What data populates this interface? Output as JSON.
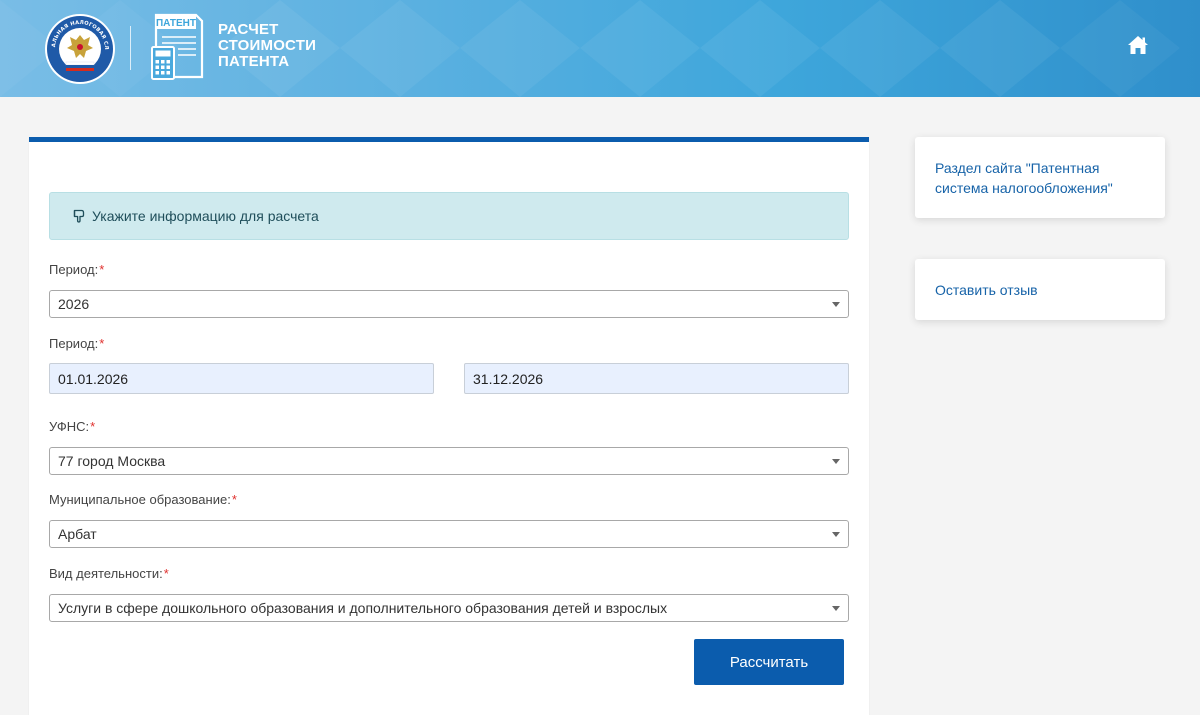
{
  "header": {
    "app_title": "РАСЧЕТ\nСТОИМОСТИ\nПАТЕНТА",
    "patent_icon_label": "ПАТЕНТ",
    "emblem_text": "ФЕДЕРАЛЬНАЯ НАЛОГОВАЯ СЛУЖБА",
    "home_icon": "home-icon"
  },
  "form": {
    "info_icon": "pointing-hand-icon",
    "info_text": "Укажите информацию для расчета",
    "required_mark": "*",
    "period_year": {
      "label": "Период:",
      "value": "2026"
    },
    "period_dates": {
      "label": "Период:",
      "start": "01.01.2026",
      "end": "31.12.2026"
    },
    "ufns": {
      "label": "УФНС:",
      "value": "77 город Москва"
    },
    "municipality": {
      "label": "Муниципальное образование:",
      "value": "Арбат"
    },
    "activity": {
      "label": "Вид деятельности:",
      "value": "Услуги в сфере дошкольного образования и дополнительного образования детей и взрослых"
    },
    "submit_label": "Рассчитать"
  },
  "sidebar": {
    "links": [
      {
        "label": "Раздел сайта \"Патентная система налогообложения\""
      },
      {
        "label": "Оставить отзыв"
      }
    ]
  },
  "colors": {
    "primary": "#0b5cad",
    "info_bg": "#cfeaee",
    "link": "#1763a8",
    "required": "#e0302d",
    "date_bg": "#e8f0fe"
  }
}
